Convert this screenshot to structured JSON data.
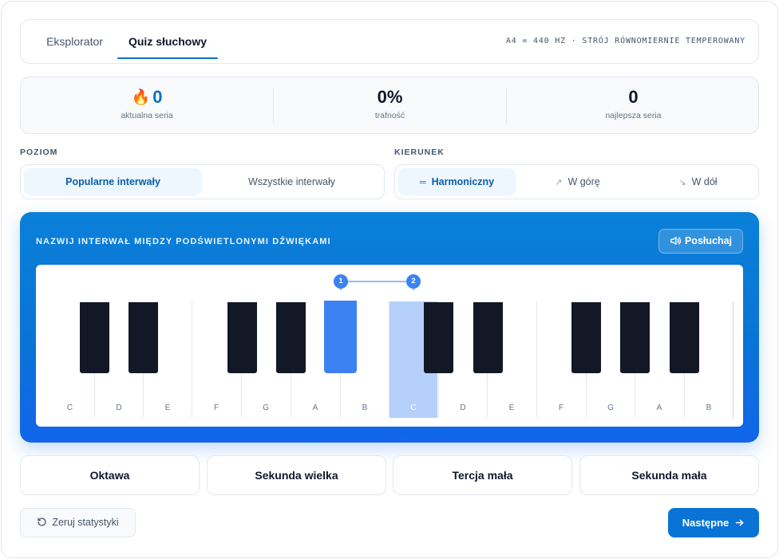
{
  "tabs": [
    {
      "label": "Eksplorator",
      "active": false
    },
    {
      "label": "Quiz słuchowy",
      "active": true
    }
  ],
  "tuning_info": "A4 = 440 HZ · STRÓJ RÓWNOMIERNIE TEMPEROWANY",
  "stats": {
    "streak": {
      "value": "0",
      "label": "aktualna seria",
      "icon": "flame-icon"
    },
    "accuracy": {
      "value": "0%",
      "label": "trafność"
    },
    "best": {
      "value": "0",
      "label": "najlepsza seria"
    }
  },
  "level": {
    "label": "POZIOM",
    "options": [
      "Popularne interwały",
      "Wszystkie interwały"
    ],
    "selected": "Popularne interwały"
  },
  "direction": {
    "label": "KIERUNEK",
    "options": [
      {
        "label": "Harmoniczny",
        "icon": "equals-icon"
      },
      {
        "label": "W górę",
        "icon": "arrow-up-right-icon"
      },
      {
        "label": "W dół",
        "icon": "arrow-down-right-icon"
      }
    ],
    "selected": "Harmoniczny"
  },
  "quiz": {
    "prompt": "NAZWIJ INTERWAŁ MIĘDZY PODŚWIETLONYMI DŹWIĘKAMI",
    "listen_label": "Posłuchaj",
    "white_keys": [
      "C",
      "D",
      "E",
      "F",
      "G",
      "A",
      "B",
      "C",
      "D",
      "E",
      "F",
      "G",
      "A",
      "B"
    ],
    "highlighted_notes": [
      {
        "marker": "1",
        "note": "A#",
        "key_type": "black"
      },
      {
        "marker": "2",
        "note": "C",
        "key_type": "white"
      }
    ]
  },
  "answers": [
    "Oktawa",
    "Sekunda wielka",
    "Tercja mała",
    "Sekunda mała"
  ],
  "footer": {
    "reset_label": "Zeruj statystyki",
    "next_label": "Następne"
  },
  "colors": {
    "accent": "#0a74d6",
    "highlight_black": "#3d82f2",
    "highlight_white": "#b5d0fb",
    "black_key": "#121826"
  }
}
